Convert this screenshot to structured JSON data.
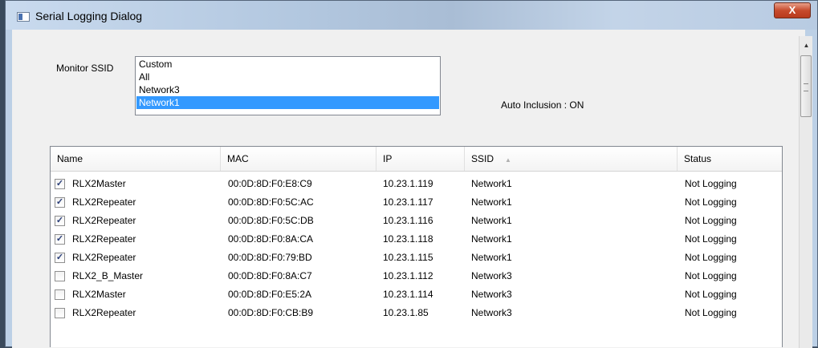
{
  "window": {
    "title": "Serial Logging Dialog",
    "close_label": "X",
    "app_icon": "window-app-icon"
  },
  "scrollbar": {
    "up_arrow": "▲",
    "grip": "≡"
  },
  "monitor": {
    "label": "Monitor SSID",
    "options": [
      "Custom",
      "All",
      "Network3",
      "Network1"
    ],
    "selected": "Network1"
  },
  "auto_inclusion": "Auto Inclusion : ON",
  "table": {
    "columns": [
      "Name",
      "MAC",
      "IP",
      "SSID",
      "Status"
    ],
    "sort_indicator": "▲",
    "rows": [
      {
        "checked": true,
        "name": "RLX2Master",
        "mac": "00:0D:8D:F0:E8:C9",
        "ip": "10.23.1.119",
        "ssid": "Network1",
        "status": "Not Logging"
      },
      {
        "checked": true,
        "name": "RLX2Repeater",
        "mac": "00:0D:8D:F0:5C:AC",
        "ip": "10.23.1.117",
        "ssid": "Network1",
        "status": "Not Logging"
      },
      {
        "checked": true,
        "name": "RLX2Repeater",
        "mac": "00:0D:8D:F0:5C:DB",
        "ip": "10.23.1.116",
        "ssid": "Network1",
        "status": "Not Logging"
      },
      {
        "checked": true,
        "name": "RLX2Repeater",
        "mac": "00:0D:8D:F0:8A:CA",
        "ip": "10.23.1.118",
        "ssid": "Network1",
        "status": "Not Logging"
      },
      {
        "checked": true,
        "name": "RLX2Repeater",
        "mac": "00:0D:8D:F0:79:BD",
        "ip": "10.23.1.115",
        "ssid": "Network1",
        "status": "Not Logging"
      },
      {
        "checked": false,
        "name": "RLX2_B_Master",
        "mac": "00:0D:8D:F0:8A:C7",
        "ip": "10.23.1.112",
        "ssid": "Network3",
        "status": "Not Logging"
      },
      {
        "checked": false,
        "name": "RLX2Master",
        "mac": "00:0D:8D:F0:E5:2A",
        "ip": "10.23.1.114",
        "ssid": "Network3",
        "status": "Not Logging"
      },
      {
        "checked": false,
        "name": "RLX2Repeater",
        "mac": "00:0D:8D:F0:CB:B9",
        "ip": "10.23.1.85",
        "ssid": "Network3",
        "status": "Not Logging"
      }
    ]
  },
  "colors": {
    "selection": "#3399ff",
    "checkmark": "#2a3e78",
    "close_button": "#c74b2d"
  }
}
